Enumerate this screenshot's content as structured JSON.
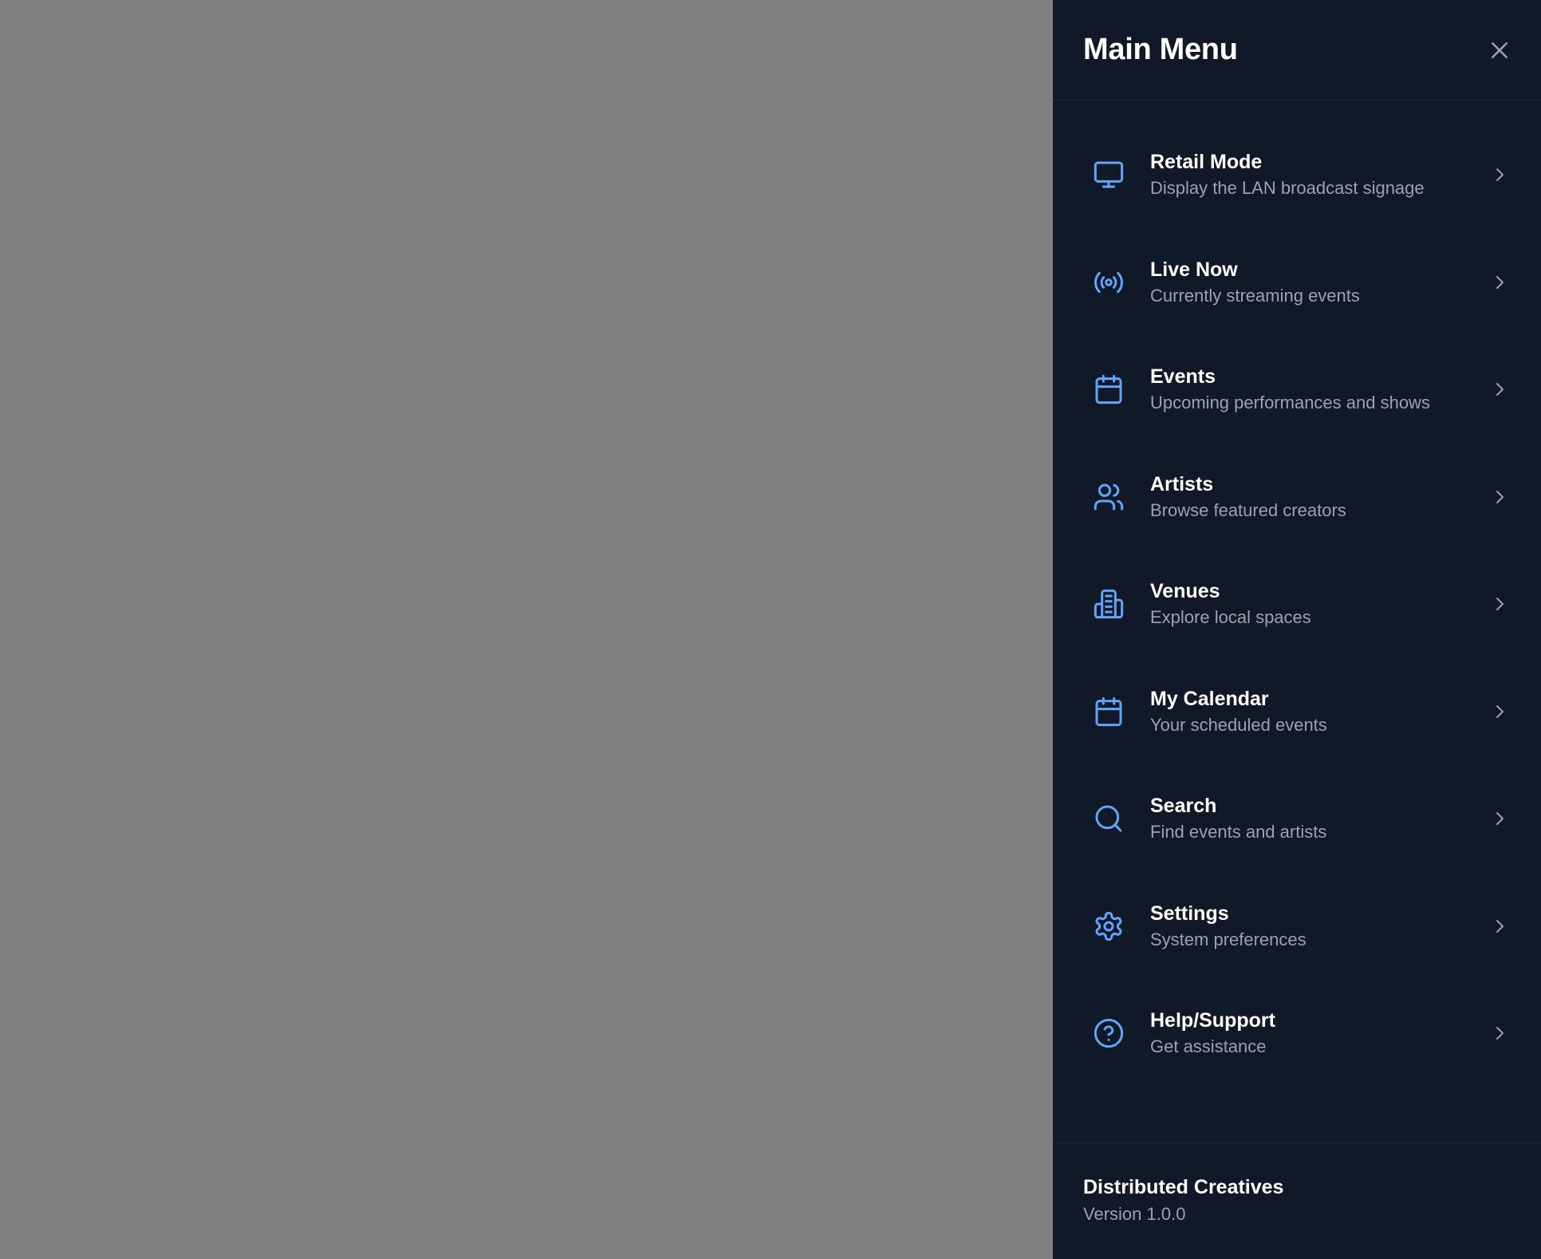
{
  "colors": {
    "overlay": "#808080",
    "drawer_bg": "#111827",
    "divider": "#1f2937",
    "accent_icon": "#60a5fa",
    "text_primary": "#ffffff",
    "text_secondary": "#9ca3af",
    "chevron": "#9ca3af"
  },
  "drawer": {
    "title": "Main Menu",
    "close_icon": "close-icon"
  },
  "menu": {
    "items": [
      {
        "label": "Retail Mode",
        "description": "Display the LAN broadcast signage",
        "icon": "monitor-icon"
      },
      {
        "label": "Live Now",
        "description": "Currently streaming events",
        "icon": "broadcast-icon"
      },
      {
        "label": "Events",
        "description": "Upcoming performances and shows",
        "icon": "calendar-icon"
      },
      {
        "label": "Artists",
        "description": "Browse featured creators",
        "icon": "users-icon"
      },
      {
        "label": "Venues",
        "description": "Explore local spaces",
        "icon": "building-icon"
      },
      {
        "label": "My Calendar",
        "description": "Your scheduled events",
        "icon": "calendar-icon"
      },
      {
        "label": "Search",
        "description": "Find events and artists",
        "icon": "search-icon"
      },
      {
        "label": "Settings",
        "description": "System preferences",
        "icon": "gear-icon"
      },
      {
        "label": "Help/Support",
        "description": "Get assistance",
        "icon": "help-circle-icon"
      }
    ]
  },
  "footer": {
    "name": "Distributed Creatives",
    "version": "Version 1.0.0"
  }
}
